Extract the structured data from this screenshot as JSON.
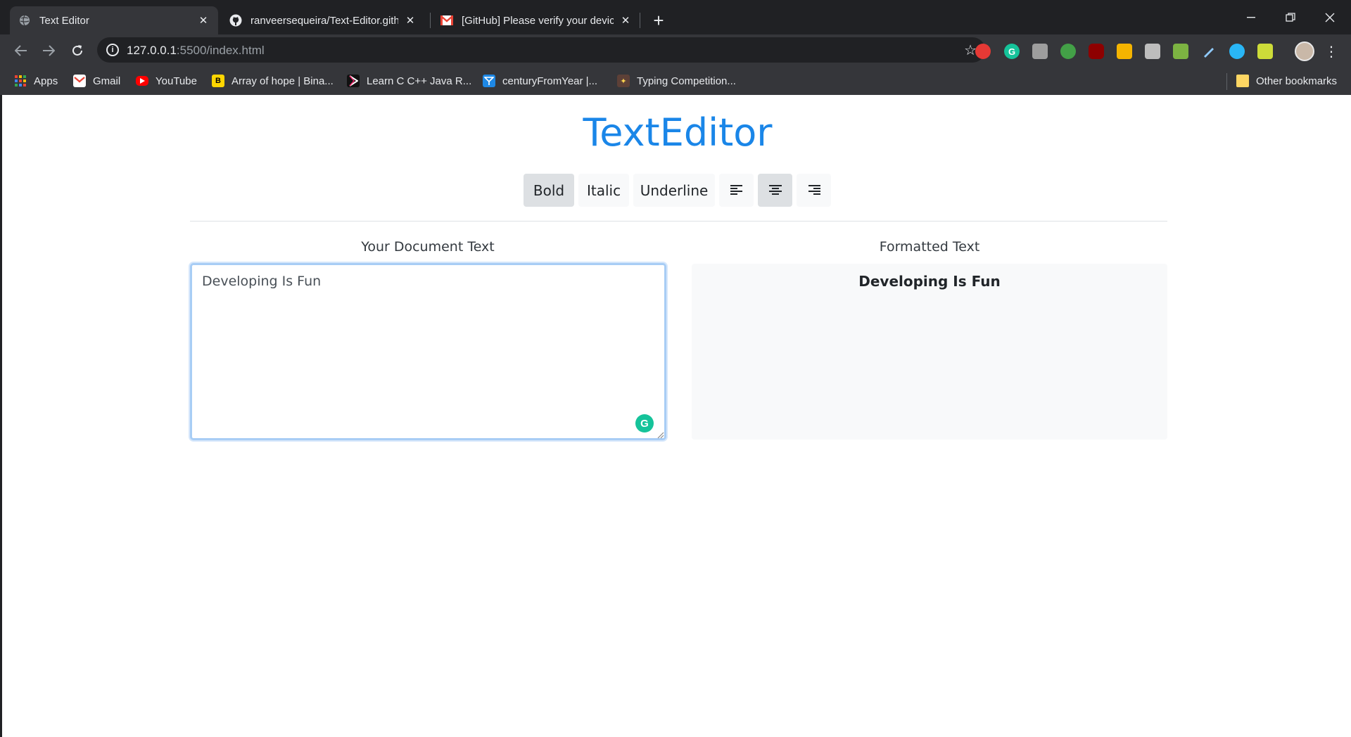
{
  "browser": {
    "tabs": [
      {
        "title": "Text Editor",
        "active": true,
        "icon": "globe-icon"
      },
      {
        "title": "ranveersequeira/Text-Editor.githu",
        "active": false,
        "icon": "github-icon"
      },
      {
        "title": "[GitHub] Please verify your devic",
        "active": false,
        "icon": "gmail-icon"
      }
    ],
    "address": {
      "host": "127.0.0.1",
      "rest": ":5500/index.html"
    },
    "bookmarks": [
      {
        "label": "Apps",
        "icon": "apps-grid-icon"
      },
      {
        "label": "Gmail",
        "icon": "gmail-icon"
      },
      {
        "label": "YouTube",
        "icon": "youtube-icon"
      },
      {
        "label": "Array of hope | Bina...",
        "icon": "b-icon"
      },
      {
        "label": "Learn C C++ Java R...",
        "icon": "play-icon"
      },
      {
        "label": "centuryFromYear |...",
        "icon": "codesignal-icon"
      },
      {
        "label": "Typing Competition...",
        "icon": "typing-icon"
      }
    ],
    "other_bookmarks": "Other bookmarks"
  },
  "app": {
    "title": "TextEditor",
    "buttons": {
      "bold": "Bold",
      "italic": "Italic",
      "underline": "Underline"
    },
    "active": [
      "bold",
      "align-center"
    ],
    "left_label": "Your Document Text",
    "right_label": "Formatted Text",
    "document_text": "Developing Is Fun",
    "formatted_text": "Developing Is Fun"
  },
  "colors": {
    "title": "#1a86e8",
    "chrome_dark": "#202124",
    "chrome_mid": "#35363a"
  }
}
